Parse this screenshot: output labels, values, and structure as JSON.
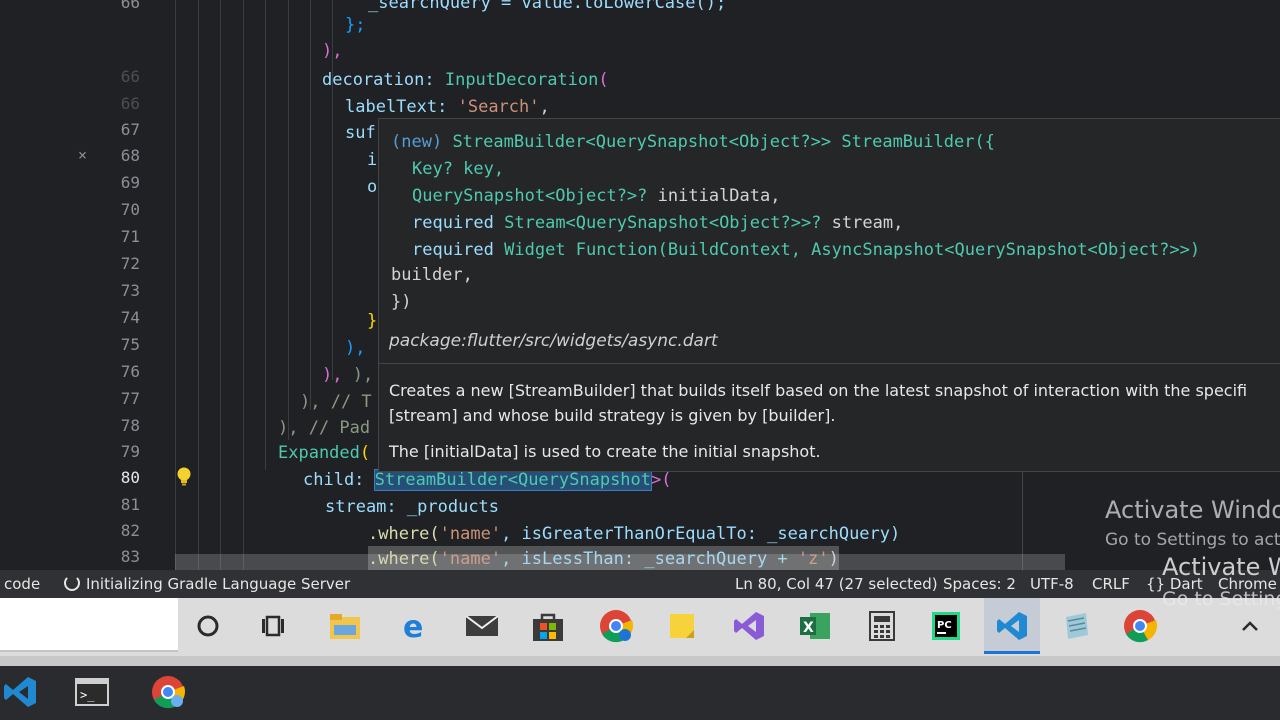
{
  "editor": {
    "line_numbers": [
      "66",
      "66",
      "67",
      "68",
      "69",
      "70",
      "71",
      "72",
      "73",
      "74",
      "75",
      "76",
      "77",
      "78",
      "79",
      "80",
      "81",
      "82",
      "83"
    ],
    "active_line": "80",
    "code": {
      "l0": "_searchQuery = value.toLowerCase();",
      "l1": "};",
      "l2": "),",
      "l3_kw": "decoration:",
      "l3_cls": "InputDecoration",
      "l4_kw": "labelText:",
      "l4_str": "'Search'",
      "l5": "suf",
      "l6": "i",
      "l7": "o",
      "l8": "}",
      "l9": "),",
      "l10": "), //",
      "l11": "), // T",
      "l12": "), // Pad",
      "l13_cls": "Expanded",
      "l14_kw": "child:",
      "l14_sel": "StreamBuilder<QuerySnapshot",
      "l14_rest": ">(",
      "l15_kw": "stream:",
      "l15_val": "_products",
      "l16_a": ".where(",
      "l16_str": "'name'",
      "l16_b": ", isGreaterThanOrEqualTo: _searchQuery)",
      "l17_a": ".where(",
      "l17_str": "'name'",
      "l17_b": ", isLessThan: _searchQuery + ",
      "l17_str2": "'z'",
      "l17_c": ")"
    }
  },
  "hover": {
    "sig_new": "(new)",
    "sig_type": "StreamBuilder",
    "sig_generic": "<QuerySnapshot<Object?>>",
    "sig_ctor": "StreamBuilder({",
    "p1": "Key? key,",
    "p2_type": "QuerySnapshot<Object?>?",
    "p2_name": "initialData,",
    "p3_req": "required",
    "p3_type": "Stream<QuerySnapshot<Object?>>?",
    "p3_name": "stream,",
    "p4_req": "required",
    "p4_type": "Widget Function(BuildContext, AsyncSnapshot<QuerySnapshot<Object?>>)",
    "p4_name": "builder,",
    "close": "})",
    "package": "package:flutter/src/widgets/async.dart",
    "doc1": "Creates a new [StreamBuilder] that builds itself based on the latest snapshot of interaction with the specifi",
    "doc2": "[stream] and whose build strategy is given by [builder].",
    "doc3": "The [initialData] is used to create the initial snapshot."
  },
  "watermark": {
    "title": "Activate Windo",
    "sub": "Go to Settings to act",
    "title2": "Activate Wind",
    "sub2": "Go to Setting"
  },
  "statusbar": {
    "left_label": "code",
    "task": "Initializing Gradle Language Server",
    "position": "Ln 80, Col 47 (27 selected)",
    "spaces": "Spaces: 2",
    "encoding": "UTF-8",
    "eol": "CRLF",
    "language": "Dart",
    "extra": "Chrome"
  },
  "colors": {
    "accent_blue": "#1e74d2",
    "editor_bg": "#1f2124",
    "selection": "#264f78"
  }
}
